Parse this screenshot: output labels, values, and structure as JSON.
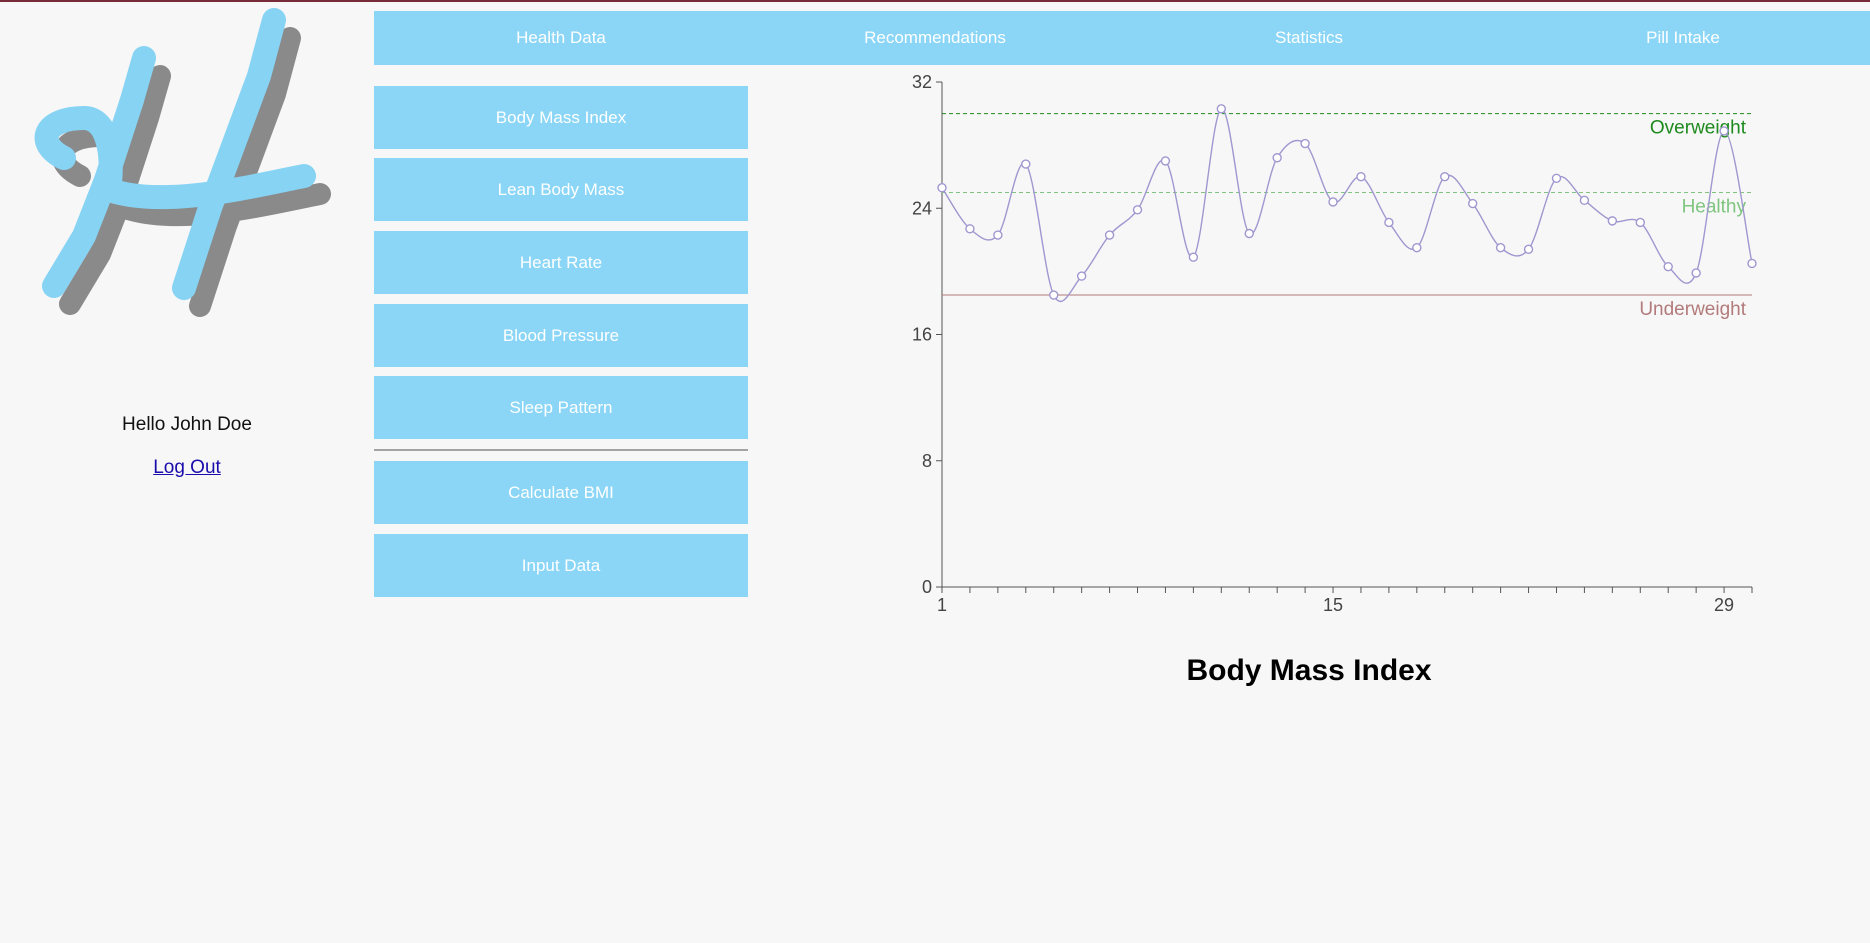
{
  "user": {
    "greeting": "Hello John Doe",
    "logout_label": "Log Out"
  },
  "topnav": {
    "items": [
      "Health Data",
      "Recommendations",
      "Statistics",
      "Pill Intake"
    ]
  },
  "sidebar": {
    "buttons": [
      "Body Mass Index",
      "Lean Body Mass",
      "Heart Rate",
      "Blood Pressure",
      "Sleep Pattern"
    ],
    "actions": [
      "Calculate BMI",
      "Input Data"
    ]
  },
  "colors": {
    "accent": "#8bd6f6",
    "line": "#9f97cf",
    "overweight": "#1e8a1e",
    "healthy": "#7fc57f",
    "underweight": "#b27a7a"
  },
  "chart_data": {
    "type": "line",
    "title": "Body Mass Index",
    "xlabel": "",
    "ylabel": "",
    "x": [
      1,
      2,
      3,
      4,
      5,
      6,
      7,
      8,
      9,
      10,
      11,
      12,
      13,
      14,
      15,
      16,
      17,
      18,
      19,
      20,
      21,
      22,
      23,
      24,
      25,
      26,
      27,
      28,
      29,
      30
    ],
    "xticks": [
      "1",
      "15",
      "29"
    ],
    "yticks": [
      "0",
      "8",
      "16",
      "24",
      "32"
    ],
    "ylim": [
      0,
      32
    ],
    "xlim": [
      1,
      30
    ],
    "series": [
      {
        "values": [
          25.3,
          22.7,
          22.3,
          26.8,
          18.5,
          19.7,
          22.3,
          23.9,
          27.0,
          20.9,
          30.3,
          22.4,
          27.2,
          28.1,
          24.4,
          26.0,
          23.1,
          21.5,
          26.0,
          24.3,
          21.5,
          21.4,
          25.9,
          24.5,
          23.2,
          23.1,
          20.3,
          19.9,
          28.9,
          20.5
        ]
      }
    ],
    "reference_lines": [
      {
        "label": "Overweight",
        "value": 30,
        "style": "dashed",
        "color": "#1e8a1e"
      },
      {
        "label": "Healthy",
        "value": 25,
        "style": "dashed",
        "color": "#7fc57f"
      },
      {
        "label": "Underweight",
        "value": 18.5,
        "style": "solid",
        "color": "#b27a7a"
      }
    ],
    "grid": false
  }
}
